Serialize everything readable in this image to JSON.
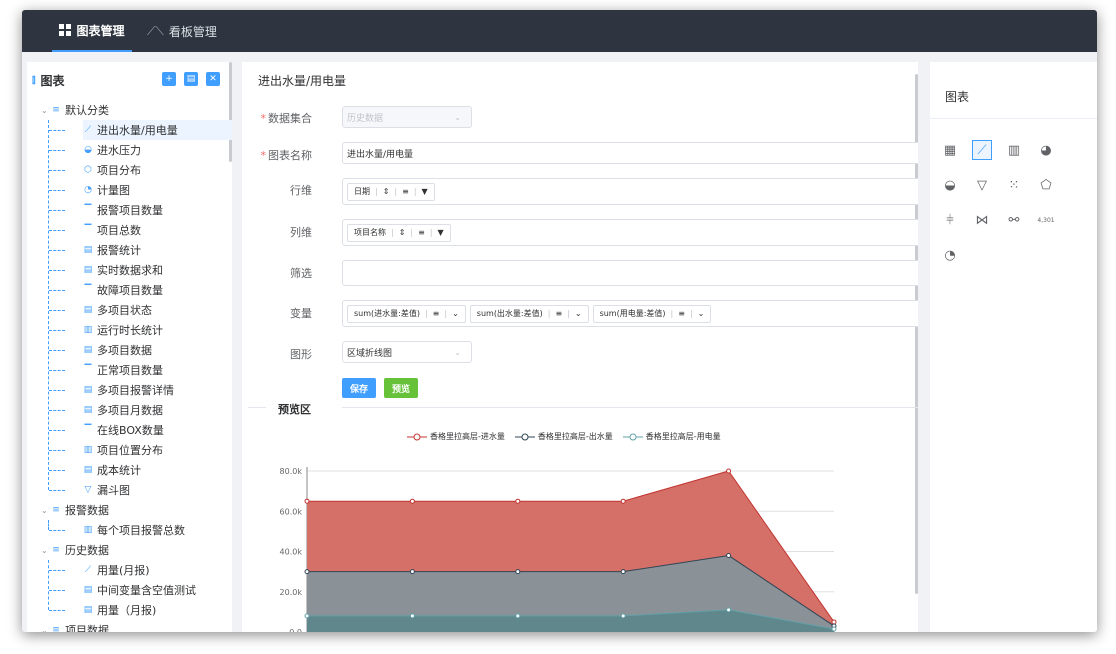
{
  "topbar": {
    "tabs": [
      {
        "label": "图表管理",
        "icon": "grid-icon",
        "active": true
      },
      {
        "label": "看板管理",
        "icon": "line-chart-icon",
        "active": false
      }
    ],
    "background": "#2f3540"
  },
  "sidebar": {
    "title": "图表",
    "title_icon": "bar-chart-icon",
    "actions": [
      "add-icon",
      "folder-icon",
      "delete-icon"
    ],
    "groups": [
      {
        "label": "默认分类",
        "expanded": true,
        "items": [
          {
            "label": "进出水量/用电量",
            "icon": "line-chart-icon",
            "selected": true
          },
          {
            "label": "进水压力",
            "icon": "pie-chart-icon"
          },
          {
            "label": "项目分布",
            "icon": "radar-chart-icon"
          },
          {
            "label": "计量图",
            "icon": "gauge-icon"
          },
          {
            "label": "报警项目数量",
            "icon": "number-icon"
          },
          {
            "label": "项目总数",
            "icon": "number-icon"
          },
          {
            "label": "报警统计",
            "icon": "table-icon"
          },
          {
            "label": "实时数据求和",
            "icon": "table-icon"
          },
          {
            "label": "故障项目数量",
            "icon": "number-icon"
          },
          {
            "label": "多项目状态",
            "icon": "table-icon"
          },
          {
            "label": "运行时长统计",
            "icon": "bar-chart-icon"
          },
          {
            "label": "多项目数据",
            "icon": "table-icon"
          },
          {
            "label": "正常项目数量",
            "icon": "number-icon"
          },
          {
            "label": "多项目报警详情",
            "icon": "table-icon"
          },
          {
            "label": "多项目月数据",
            "icon": "table-icon"
          },
          {
            "label": "在线BOX数量",
            "icon": "number-icon"
          },
          {
            "label": "项目位置分布",
            "icon": "bar-chart-icon"
          },
          {
            "label": "成本统计",
            "icon": "table-icon"
          },
          {
            "label": "漏斗图",
            "icon": "funnel-icon"
          }
        ]
      },
      {
        "label": "报警数据",
        "expanded": true,
        "items": [
          {
            "label": "每个项目报警总数",
            "icon": "bar-chart-icon"
          }
        ]
      },
      {
        "label": "历史数据",
        "expanded": true,
        "items": [
          {
            "label": "用量(月报)",
            "icon": "line-chart-icon"
          },
          {
            "label": "中间变量含空值测试",
            "icon": "table-icon"
          },
          {
            "label": "用量（月报)",
            "icon": "table-icon"
          }
        ]
      },
      {
        "label": "项目数据",
        "expanded": true,
        "items": []
      }
    ]
  },
  "editor": {
    "title": "进出水量/用电量",
    "fields": {
      "dataset": {
        "label": "数据集合",
        "required": true,
        "value": "历史数据"
      },
      "chart_name": {
        "label": "图表名称",
        "required": true,
        "value": "进出水量/用电量"
      },
      "row_dim": {
        "label": "行维",
        "chips": [
          {
            "text": "日期"
          }
        ]
      },
      "col_dim": {
        "label": "列维",
        "chips": [
          {
            "text": "项目名称"
          }
        ]
      },
      "filter": {
        "label": "筛选",
        "value": ""
      },
      "variable": {
        "label": "变量",
        "chips": [
          {
            "text": "sum(进水量:差值)"
          },
          {
            "text": "sum(出水量:差值)"
          },
          {
            "text": "sum(用电量:差值)"
          }
        ]
      },
      "chart_type": {
        "label": "图形",
        "value": "区域折线图"
      }
    },
    "chip_controls": {
      "sort": "⇕",
      "align": "≡",
      "filter": "▼",
      "dropdown": "⌄"
    },
    "buttons": {
      "save": "保存",
      "preview": "预览"
    },
    "colors": {
      "save": "#409eff",
      "preview": "#67c23a"
    },
    "preview_label": "预览区"
  },
  "chart_data": {
    "type": "area",
    "stacked": true,
    "x": [
      "",
      "",
      "",
      "",
      "",
      ""
    ],
    "ylim": [
      0,
      80000
    ],
    "yticks": [
      "0.0",
      "20.0k",
      "40.0k",
      "60.0k",
      "80.0k"
    ],
    "grid": true,
    "legend_position": "top",
    "series": [
      {
        "name": "香格里拉高层-进水量",
        "color": "#c23531",
        "values": [
          35000,
          35000,
          35000,
          35000,
          42000,
          2000
        ]
      },
      {
        "name": "香格里拉高层-出水量",
        "color": "#2f4554",
        "values": [
          22000,
          22000,
          22000,
          22000,
          27000,
          1500
        ]
      },
      {
        "name": "香格里拉高层-用电量",
        "color": "#61a0a8",
        "values": [
          8000,
          8000,
          8000,
          8000,
          11000,
          1500
        ]
      }
    ]
  },
  "chart_picker": {
    "title": "图表",
    "icons": [
      {
        "name": "table-icon",
        "glyph": "▦",
        "active": false
      },
      {
        "name": "line-chart-icon",
        "glyph": "⟋",
        "active": true
      },
      {
        "name": "bar-chart-icon",
        "glyph": "▥",
        "active": false
      },
      {
        "name": "pie-chart-icon",
        "glyph": "◕",
        "active": false
      },
      {
        "name": "area-chart-icon",
        "glyph": "◒",
        "active": false
      },
      {
        "name": "funnel-icon",
        "glyph": "▽",
        "active": false
      },
      {
        "name": "scatter-icon",
        "glyph": "⁙",
        "active": false
      },
      {
        "name": "radar-icon",
        "glyph": "⬠",
        "active": false
      },
      {
        "name": "parallel-icon",
        "glyph": "⫩",
        "active": false
      },
      {
        "name": "sankey-icon",
        "glyph": "⋈",
        "active": false
      },
      {
        "name": "graph-icon",
        "glyph": "⚯",
        "active": false
      },
      {
        "name": "number-card-icon",
        "glyph": "4,301",
        "active": false
      },
      {
        "name": "gauge-icon",
        "glyph": "◔",
        "active": false
      }
    ]
  }
}
